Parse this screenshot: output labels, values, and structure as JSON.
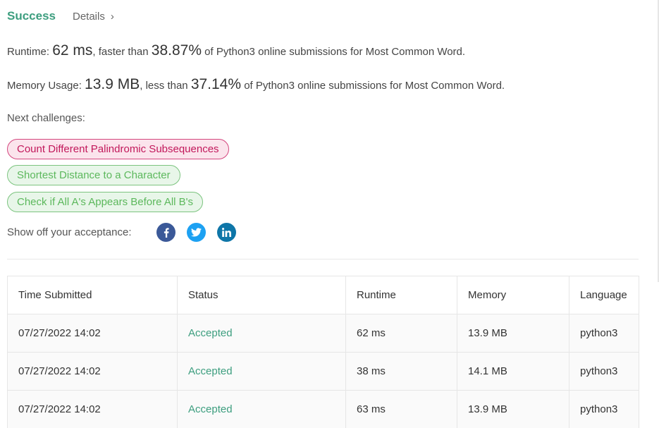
{
  "header": {
    "status": "Success",
    "details_label": "Details",
    "details_chevron": "›"
  },
  "runtime": {
    "label": "Runtime: ",
    "value": "62 ms",
    "comparison": ", faster than ",
    "percent": "38.87%",
    "suffix": " of Python3 online submissions for Most Common Word."
  },
  "memory": {
    "label": "Memory Usage: ",
    "value": "13.9 MB",
    "comparison": ", less than ",
    "percent": "37.14%",
    "suffix": " of Python3 online submissions for Most Common Word."
  },
  "next_challenges": {
    "label": "Next challenges:",
    "items": [
      {
        "title": "Count Different Palindromic Subsequences",
        "difficulty": "hard",
        "color": "#c2185b"
      },
      {
        "title": "Shortest Distance to a Character",
        "difficulty": "easy",
        "color": "#5cb85c"
      },
      {
        "title": "Check if All A's Appears Before All B's",
        "difficulty": "easy",
        "color": "#5cb85c"
      }
    ]
  },
  "share": {
    "label": "Show off your acceptance:",
    "icons": [
      {
        "name": "facebook-icon",
        "color": "#3b5998"
      },
      {
        "name": "twitter-icon",
        "color": "#1da1f2"
      },
      {
        "name": "linkedin-icon",
        "color": "#0e76a8"
      }
    ]
  },
  "table": {
    "columns": [
      "Time Submitted",
      "Status",
      "Runtime",
      "Memory",
      "Language"
    ],
    "rows": [
      {
        "time": "07/27/2022 14:02",
        "status": "Accepted",
        "runtime": "62 ms",
        "memory": "13.9 MB",
        "language": "python3"
      },
      {
        "time": "07/27/2022 14:02",
        "status": "Accepted",
        "runtime": "38 ms",
        "memory": "14.1 MB",
        "language": "python3"
      },
      {
        "time": "07/27/2022 14:02",
        "status": "Accepted",
        "runtime": "63 ms",
        "memory": "13.9 MB",
        "language": "python3"
      }
    ]
  },
  "colors": {
    "success_green": "#3d9e7f",
    "hard_pink": "#c2185b",
    "easy_green": "#5cb85c"
  }
}
